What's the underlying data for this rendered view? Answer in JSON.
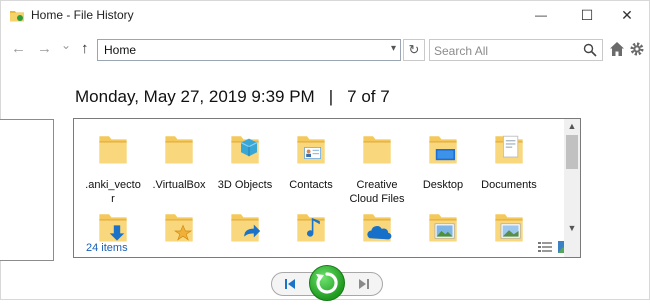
{
  "window": {
    "title": "Home - File History",
    "minimize_glyph": "—",
    "maximize_glyph": "☐",
    "close_glyph": "✕"
  },
  "nav": {
    "back_glyph": "←",
    "forward_glyph": "→",
    "recent_glyph": "⌄",
    "up_glyph": "↑",
    "address": "Home",
    "refresh_glyph": "↻",
    "search_placeholder": "Search All"
  },
  "snapshot": {
    "date": "Monday, May 27, 2019 9:39 PM",
    "separator": "|",
    "position": "7 of 7"
  },
  "items": [
    {
      "label": "anki_vecto r",
      "display": ".anki_vecto\nr",
      "icon": "folder-icon"
    },
    {
      "label": ".VirtualBox",
      "icon": "folder-icon"
    },
    {
      "label": "3D Objects",
      "icon": "3d-objects-folder-icon"
    },
    {
      "label": "Contacts",
      "icon": "contacts-folder-icon"
    },
    {
      "label": "Creative Cloud Files",
      "icon": "creative-cloud-folder-icon"
    },
    {
      "label": "Desktop",
      "icon": "desktop-folder-icon"
    },
    {
      "label": "Documents",
      "icon": "documents-folder-icon"
    },
    {
      "label": "",
      "icon": "downloads-folder-icon"
    },
    {
      "label": "",
      "icon": "favorites-folder-icon"
    },
    {
      "label": "",
      "icon": "links-folder-icon"
    },
    {
      "label": "",
      "icon": "music-folder-icon"
    },
    {
      "label": "",
      "icon": "onedrive-folder-icon"
    },
    {
      "label": "",
      "icon": "pictures-folder-icon"
    },
    {
      "label": "",
      "icon": "videos-folder-icon"
    }
  ],
  "item_labels": [
    ".anki_vecto\nr",
    ".VirtualBox",
    "3D Objects",
    "Contacts",
    "Creative\nCloud Files",
    "Desktop",
    "Documents"
  ],
  "status": {
    "count": "24 items"
  },
  "colors": {
    "folder": "#f4c85a",
    "folder_front": "#f9d77c",
    "accent_blue": "#1a73c8",
    "restore_green": "#2fb12f"
  }
}
